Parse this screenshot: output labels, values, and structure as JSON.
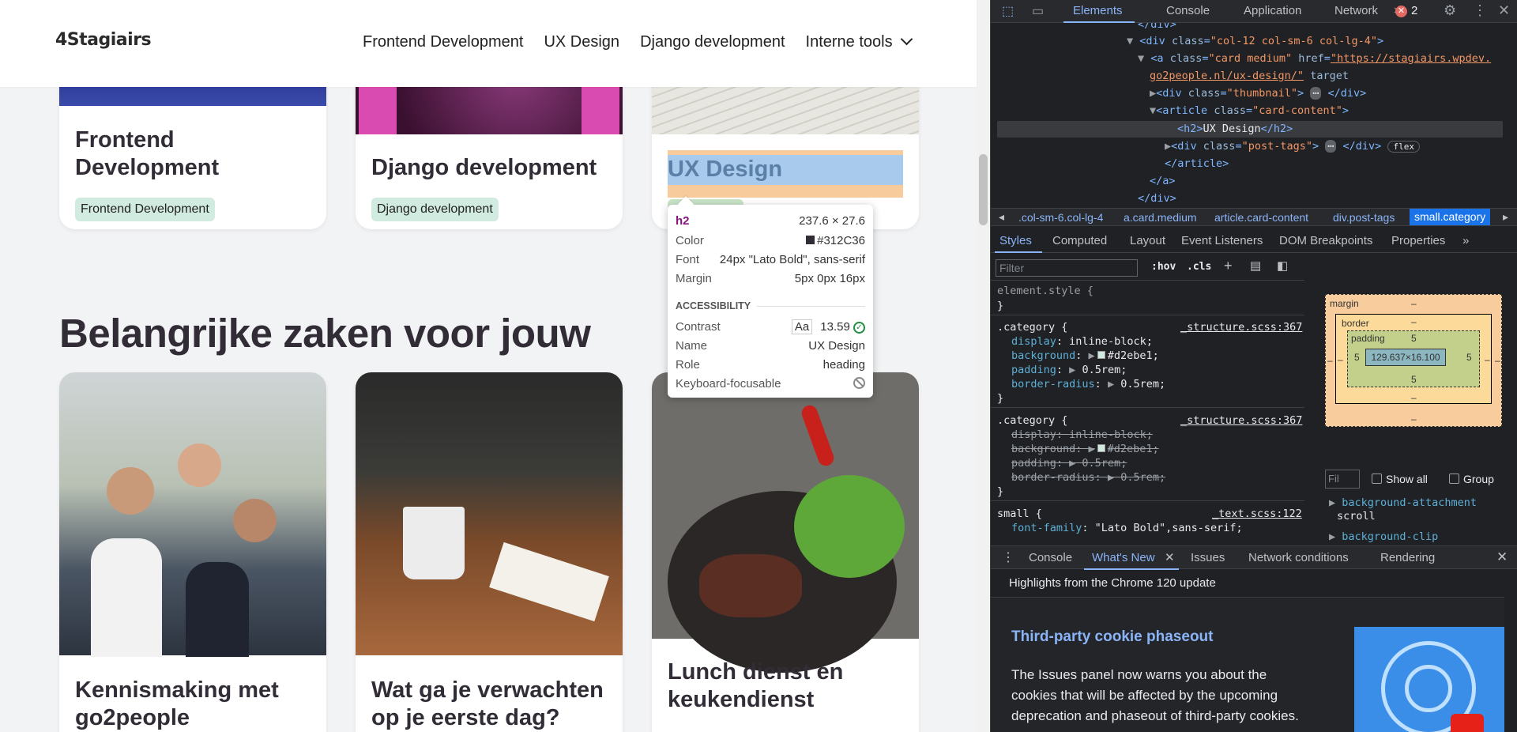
{
  "site": {
    "logo": "4Stagiairs",
    "nav": [
      "Frontend Development",
      "UX Design",
      "Django development",
      "Interne tools"
    ],
    "top_cards": [
      {
        "title_line1": "Frontend",
        "title_line2": "Development",
        "tag": "Frontend Development"
      },
      {
        "title": "Django development",
        "tag": "Django development"
      },
      {
        "title": "UX Design"
      }
    ],
    "section_title": "Belangrijke zaken voor jouw",
    "bottom_cards": [
      {
        "title_line1": "Kennismaking met",
        "title_line2": "go2people"
      },
      {
        "title_line1": "Wat ga je verwachten",
        "title_line2": "op je eerste dag?"
      },
      {
        "title_line1": "Lunch dienst en",
        "title_line2": "keukendienst"
      }
    ]
  },
  "tooltip": {
    "tag": "h2",
    "size": "237.6 × 27.6",
    "color_label": "Color",
    "color_value": "#312C36",
    "font_label": "Font",
    "font_value": "24px \"Lato Bold\", sans-serif",
    "margin_label": "Margin",
    "margin_value": "5px 0px 16px",
    "accessibility": "ACCESSIBILITY",
    "contrast_label": "Contrast",
    "contrast_aa": "Aa",
    "contrast_value": "13.59",
    "name_label": "Name",
    "name_value": "UX Design",
    "role_label": "Role",
    "role_value": "heading",
    "kf_label": "Keyboard-focusable"
  },
  "devtools": {
    "tabs": [
      "Elements",
      "Console",
      "Application",
      "Network"
    ],
    "error_count": "2",
    "dom": {
      "l0": "</div>",
      "l1_tag": "div",
      "l1_attr": "class",
      "l1_val": "\"col-12 col-sm-6 col-lg-4\"",
      "l2_tag": "a",
      "l2_attr1": "class",
      "l2_val1": "\"card medium\"",
      "l2_attr2": "href",
      "l2_val2": "\"https://stagiairs.wpdev.",
      "l2_val2b": "go2people.nl/ux-design/\"",
      "l2_attr3": "target",
      "l3_tag": "div",
      "l3_attr": "class",
      "l3_val": "\"thumbnail\"",
      "l4_tag": "article",
      "l4_attr": "class",
      "l4_val": "\"card-content\"",
      "l5_text": "UX Design",
      "l6_tag": "div",
      "l6_attr": "class",
      "l6_val": "\"post-tags\"",
      "l6_badge": "flex",
      "l7": "</article>",
      "l8": "</a>",
      "l9": "</div>"
    },
    "breadcrumbs": [
      ".col-sm-6.col-lg-4",
      "a.card.medium",
      "article.card-content",
      "div.post-tags",
      "small.category"
    ],
    "subtabs": [
      "Styles",
      "Computed",
      "Layout",
      "Event Listeners",
      "DOM Breakpoints",
      "Properties"
    ],
    "filter_placeholder": "Filter",
    "hov": ":hov",
    "cls": ".cls",
    "rules": {
      "element_style": "element.style {",
      "close": "}",
      "r1_sel": ".category {",
      "r1_src": "_structure.scss:367",
      "r2_sel": ".category {",
      "r2_src": "_structure.scss:367",
      "r3_sel": "small {",
      "r3_src": "_text.scss:122",
      "display": "display",
      "display_val": "inline-block;",
      "background": "background",
      "background_val": "#d2ebe1;",
      "padding": "padding",
      "padding_val": "0.5rem;",
      "radius": "border-radius",
      "radius_val": "0.5rem;",
      "font_family": "font-family",
      "font_family_val": "\"Lato Bold\",sans-serif;"
    },
    "boxmodel": {
      "margin": "margin",
      "border": "border",
      "padding": "padding",
      "dash": "–",
      "pad_value": "5",
      "content": "129.637×16.100"
    },
    "computed": {
      "filter": "Fil",
      "show_all": "Show all",
      "group": "Group",
      "p1": "background-attachment",
      "p1_val": "scroll",
      "p2": "background-clip"
    },
    "drawer_tabs": [
      "Console",
      "What's New",
      "Issues",
      "Network conditions",
      "Rendering"
    ],
    "whatsnew": {
      "highlights": "Highlights from the Chrome 120 update",
      "heading": "Third-party cookie phaseout",
      "body1": "The Issues panel now warns you about the",
      "body2": "cookies that will be affected by the upcoming",
      "body3": "deprecation and phaseout of third-party cookies."
    }
  }
}
